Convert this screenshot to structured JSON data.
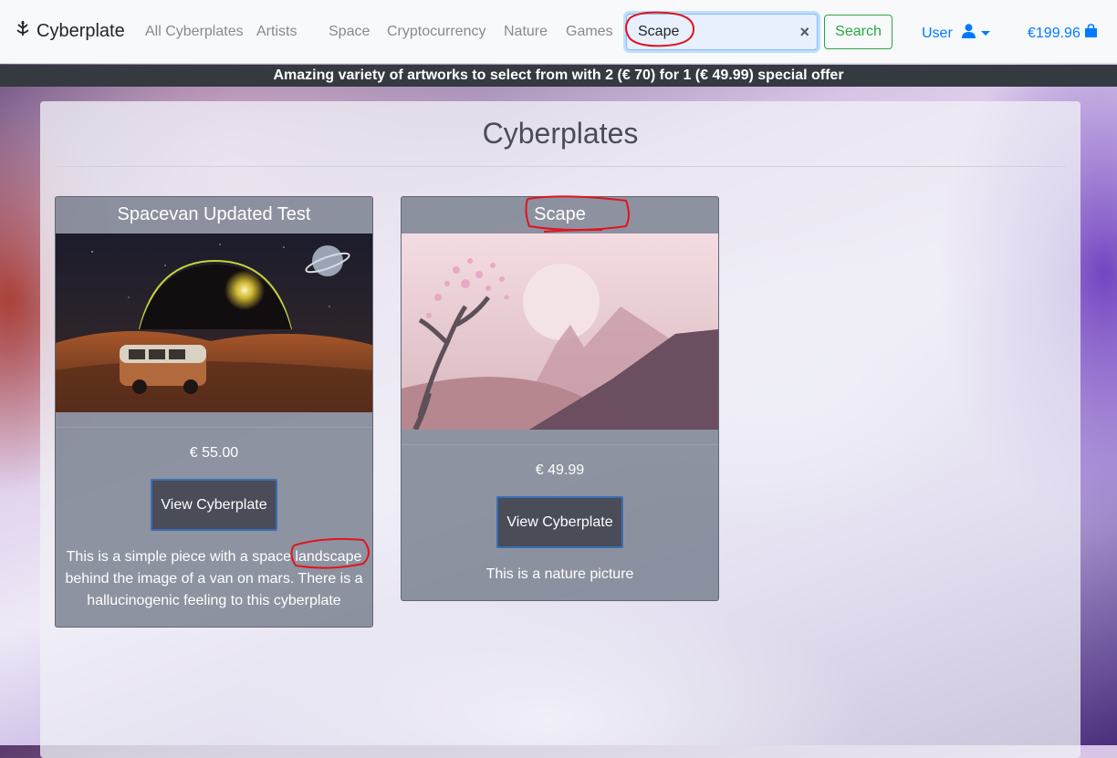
{
  "navbar": {
    "brand": "Cyberplate",
    "links": [
      "All Cyberplates",
      "Artists",
      "Space",
      "Cryptocurrency",
      "Nature",
      "Games"
    ],
    "search_value": "Scape",
    "search_button": "Search",
    "user_label": "User",
    "cart_total": "€199.96"
  },
  "promo": "Amazing variety of artworks to select from with 2 (€ 70) for 1 (€ 49.99) special offer",
  "main": {
    "title": "Cyberplates",
    "cards": [
      {
        "title": "Spacevan Updated Test",
        "price": "€ 55.00",
        "button": "View Cyberplate",
        "description": "This is a simple piece with a space landscape behind the image of a van on mars. There is a hallucinogenic feeling to this cyberplate"
      },
      {
        "title": "Scape",
        "price": "€ 49.99",
        "button": "View Cyberplate",
        "description": "This is a nature picture"
      }
    ]
  },
  "colors": {
    "primary": "#007bff",
    "success": "#28a745",
    "promo_bg": "#343a40",
    "annotation": "#e0141e"
  },
  "icons": {
    "brand": "brand-logo-icon",
    "clear": "clear-icon",
    "user": "user-icon",
    "cart": "shopping-bag-icon"
  }
}
